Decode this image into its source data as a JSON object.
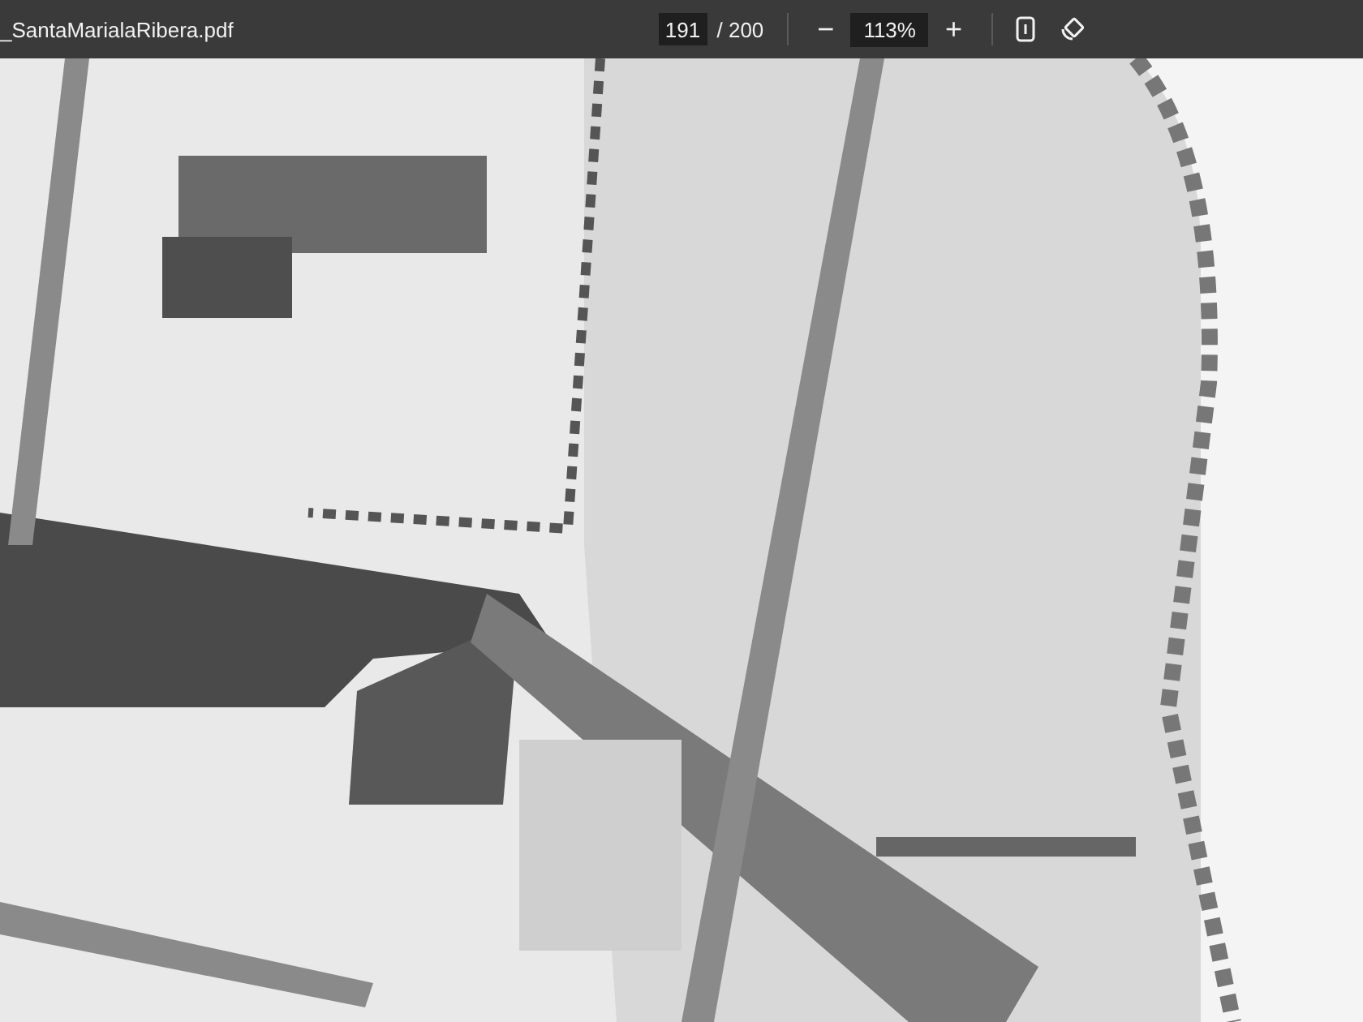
{
  "toolbar": {
    "filename": "_SantaMarialaRibera.pdf",
    "page": "191",
    "page_total": "/ 200",
    "zoom_out": "−",
    "zoom": "113%",
    "zoom_in": "+"
  }
}
